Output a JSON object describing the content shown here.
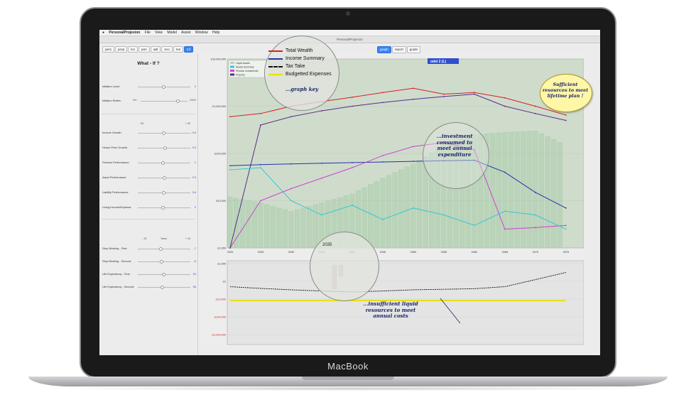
{
  "device": {
    "brand": "MacBook"
  },
  "menubar": {
    "items": [
      "PersonalProjexion",
      "File",
      "View",
      "Model",
      "Assist",
      "Window",
      "Help"
    ]
  },
  "window": {
    "title": "PersonalProjexion"
  },
  "top_tabs": [
    {
      "label": "pers"
    },
    {
      "label": "prop"
    },
    {
      "label": "inc"
    },
    {
      "label": "pen"
    },
    {
      "label": "a&l"
    },
    {
      "label": "eco"
    },
    {
      "label": "res"
    },
    {
      "label": "inf",
      "active": true
    }
  ],
  "view_tabs": [
    {
      "label": "graph",
      "active": true
    },
    {
      "label": "report"
    },
    {
      "label": "guide"
    }
  ],
  "model_label": "odel 2  (L)",
  "left_panel": {
    "title": "What - If ?",
    "sliders_a": [
      {
        "label": "Inflation Level:",
        "value": "2"
      }
    ],
    "reflex": {
      "label": "Inflation Reflex:",
      "min": "0%",
      "max": "100%"
    },
    "scale_a": {
      "min": "- 99",
      "max": "+ 99"
    },
    "sliders_b": [
      {
        "label": "Income Growth:",
        "value": "-0.6"
      },
      {
        "label": "House Price Growth:",
        "value": "0.5"
      },
      {
        "label": "Pension Performance:",
        "value": "1"
      },
      {
        "label": "Asset Performance:",
        "value": "0.5"
      },
      {
        "label": "Liability Performance:",
        "value": "0.6"
      },
      {
        "label": "Living Income/Expense:",
        "value": "0"
      }
    ],
    "scale_b": {
      "min": "- 15",
      "mid": "Years",
      "max": "+ 15"
    },
    "sliders_c": [
      {
        "label": "Stop Working - First:",
        "value": "-7"
      },
      {
        "label": "Stop Working - Second:",
        "value": "-6"
      },
      {
        "label": "Life Expectancy - First:",
        "value": "92"
      },
      {
        "label": "Life Expectancy - Second:",
        "value": "96"
      }
    ]
  },
  "chart_legend_small": [
    "Liquid Assets",
    "Assets Summary",
    "Pension Investments",
    "Property"
  ],
  "graph_key": {
    "items": [
      {
        "label": "Total Wealth",
        "color": "#d62020"
      },
      {
        "label": "Income Summary",
        "color": "#2233aa"
      },
      {
        "label": "Tax Take",
        "color": "#111111"
      },
      {
        "label": "Budgetted Expenses",
        "color": "#e8e000"
      }
    ],
    "caption": "...graph key"
  },
  "annotations": {
    "investment": "...investment consumed to meet annual expenditure",
    "sufficient": "Sufficient resources to meet lifetime plan !",
    "insufficient": "...insufficient liquid resources to meet annual costs",
    "zoom_year": "2035"
  },
  "chart_data": [
    {
      "type": "line",
      "title": "",
      "y_scale": "log",
      "ylim": [
        1000,
        10000000
      ],
      "y_ticks": [
        "£1,000",
        "£10,000",
        "£100,000",
        "£1,000,000",
        "£10,000,000"
      ],
      "x_ticks": [
        "2020",
        "2025",
        "2030",
        "2035",
        "2040",
        "2045",
        "2050",
        "2055",
        "2060",
        "2065",
        "2070",
        "2075"
      ],
      "x": [
        2020,
        2025,
        2030,
        2035,
        2040,
        2045,
        2050,
        2055,
        2060,
        2065,
        2070,
        2075
      ],
      "series": [
        {
          "name": "Total Wealth",
          "color": "#d62020",
          "values": [
            600000,
            700000,
            1000000,
            1250000,
            1550000,
            1950000,
            2400000,
            1800000,
            1950000,
            1500000,
            1000000,
            650000
          ]
        },
        {
          "name": "Income Summary",
          "color": "#2233aa",
          "values": [
            55000,
            58000,
            60000,
            62000,
            64000,
            66000,
            68000,
            70000,
            72000,
            40000,
            15000,
            7000
          ]
        },
        {
          "name": "Pension Investments",
          "color": "#d040d0",
          "values": [
            1000,
            10000,
            18000,
            30000,
            50000,
            90000,
            140000,
            170000,
            120000,
            2500,
            2700,
            3000
          ]
        },
        {
          "name": "Property",
          "color": "#5a2a88",
          "values": [
            1000,
            400000,
            600000,
            800000,
            1000000,
            1200000,
            1400000,
            1600000,
            1800000,
            1000000,
            700000,
            500000
          ]
        },
        {
          "name": "Assets Summary",
          "color": "#33c6d6",
          "values": [
            45000,
            50000,
            10000,
            5000,
            8000,
            4000,
            7000,
            5000,
            3000,
            6000,
            5000,
            2500
          ]
        }
      ],
      "bars": {
        "name": "Liquid Assets",
        "color": "#b9d4b9",
        "values": [
          12000,
          9000,
          6000,
          9000,
          14000,
          30000,
          60000,
          150000,
          250000,
          280000,
          300000,
          150000
        ]
      }
    },
    {
      "type": "line",
      "title": "",
      "y_ticks": [
        "£1,000",
        "£0",
        "-£10,000",
        "-£100,000",
        "-£1,000,000"
      ],
      "series": [
        {
          "name": "Tax Take",
          "color": "#111111",
          "values": [
            -2000,
            -2500,
            -3000,
            -3500,
            -4000,
            -3500,
            -3000,
            -2800,
            -2600,
            -2000,
            -800,
            500
          ]
        },
        {
          "name": "Budgetted Expenses",
          "color": "#e8e000",
          "values": [
            -12000,
            -12000,
            -12000,
            -12000,
            -12000,
            -12000,
            -12000,
            -12000,
            -12000,
            -12000,
            -12000,
            -12000
          ]
        }
      ]
    }
  ]
}
